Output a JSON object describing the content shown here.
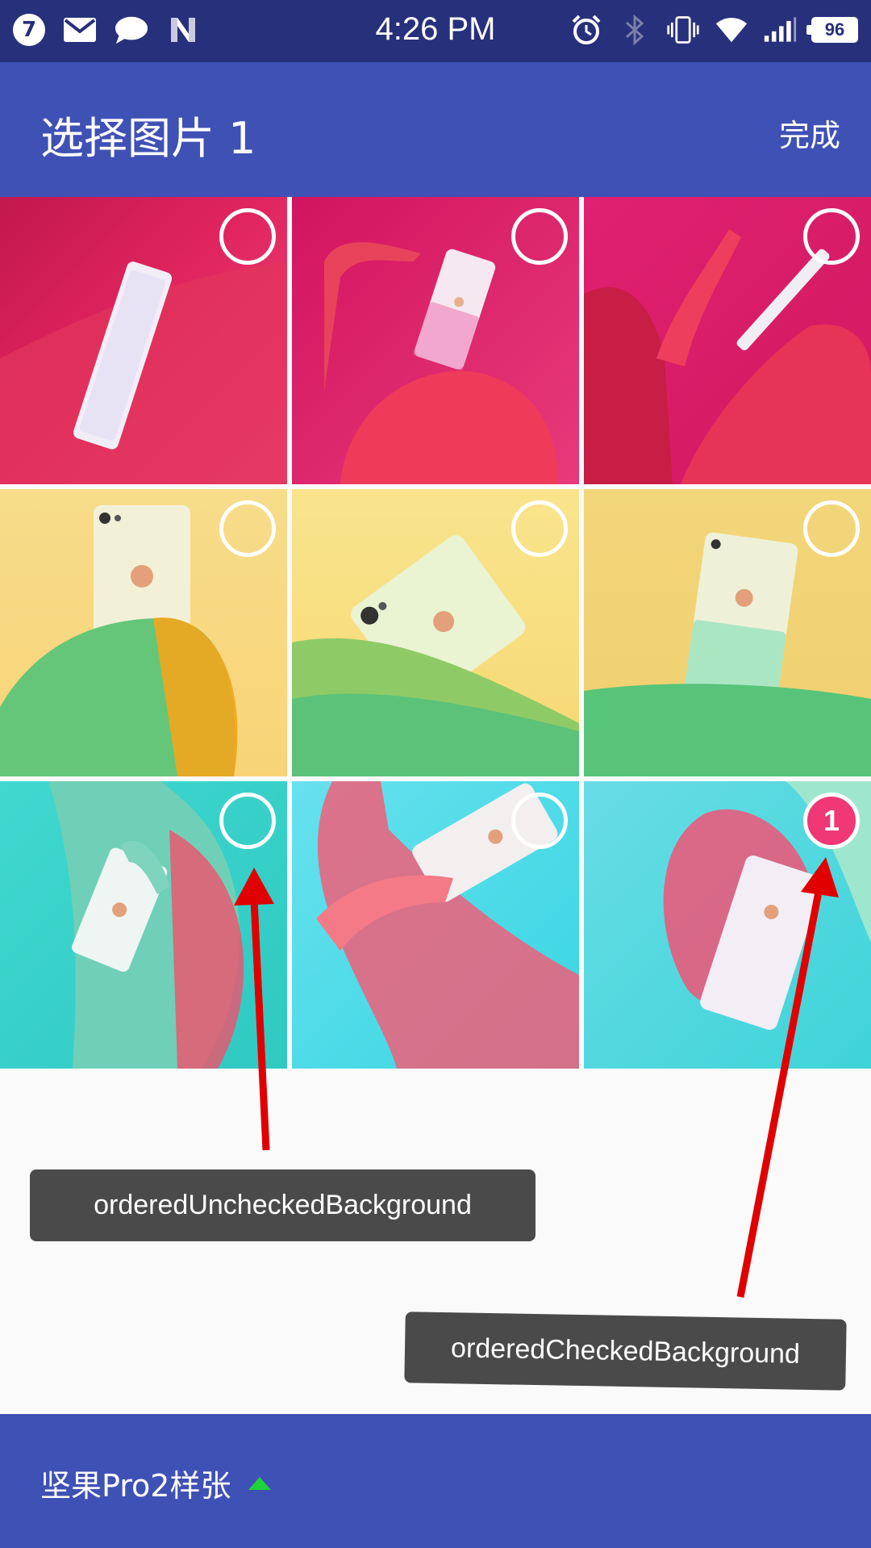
{
  "status_bar": {
    "notification_count": "7",
    "time": "4:26 PM",
    "battery": "96",
    "left_icons": [
      "mail-icon",
      "chat-icon",
      "n-icon"
    ],
    "right_icons": [
      "alarm-icon",
      "bluetooth-icon",
      "vibrate-icon",
      "wifi-icon",
      "signal-icon",
      "battery-icon"
    ]
  },
  "app_bar": {
    "title": "选择图片 1",
    "done_label": "完成"
  },
  "grid": {
    "items": [
      {
        "checked": false,
        "order": ""
      },
      {
        "checked": false,
        "order": ""
      },
      {
        "checked": false,
        "order": ""
      },
      {
        "checked": false,
        "order": ""
      },
      {
        "checked": false,
        "order": ""
      },
      {
        "checked": false,
        "order": ""
      },
      {
        "checked": false,
        "order": ""
      },
      {
        "checked": false,
        "order": ""
      },
      {
        "checked": true,
        "order": "1"
      }
    ]
  },
  "annotations": {
    "unchecked_label": "orderedUncheckedBackground",
    "checked_label": "orderedCheckedBackground"
  },
  "bottom_bar": {
    "album_name": "坚果Pro2样张"
  },
  "colors": {
    "status_bar": "#27307a",
    "primary": "#3f51b5",
    "checked_badge": "#ef3875",
    "annotation_arrow": "#e00000",
    "album_triangle": "#1fd23a"
  }
}
